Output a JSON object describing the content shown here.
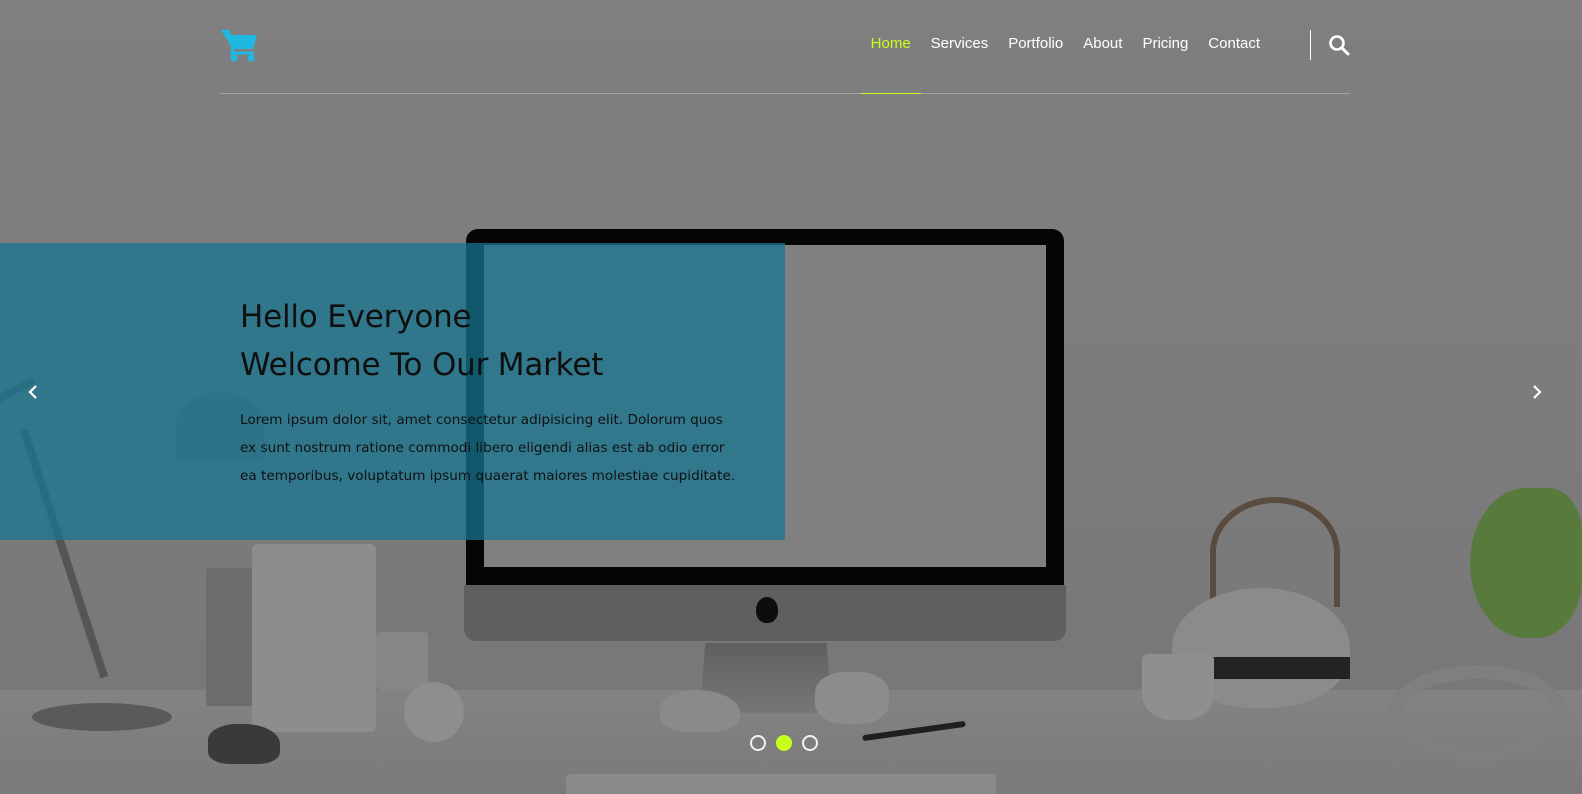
{
  "brand": {
    "logo_icon": "shopping-cart-icon",
    "logo_color": "#1fb8e3"
  },
  "nav": {
    "items": [
      {
        "label": "Home",
        "active": true
      },
      {
        "label": "Services",
        "active": false
      },
      {
        "label": "Portfolio",
        "active": false
      },
      {
        "label": "About",
        "active": false
      },
      {
        "label": "Pricing",
        "active": false
      },
      {
        "label": "Contact",
        "active": false
      }
    ],
    "search_icon": "search-icon",
    "active_color": "#c6ff1c"
  },
  "slider": {
    "title_line1": "Hello Everyone",
    "title_line2": "Welcome To Our Market",
    "text": "Lorem ipsum dolor sit, amet consectetur adipisicing elit. Dolorum quos ex sunt nostrum ratione commodi libero eligendi alias est ab odio error ea temporibus, voluptatum ipsum quaerat maiores molestiae cupiditate.",
    "panel_color": "#167691",
    "prev_icon": "chevron-left-icon",
    "next_icon": "chevron-right-icon",
    "slide_count": 3,
    "active_slide": 2
  }
}
